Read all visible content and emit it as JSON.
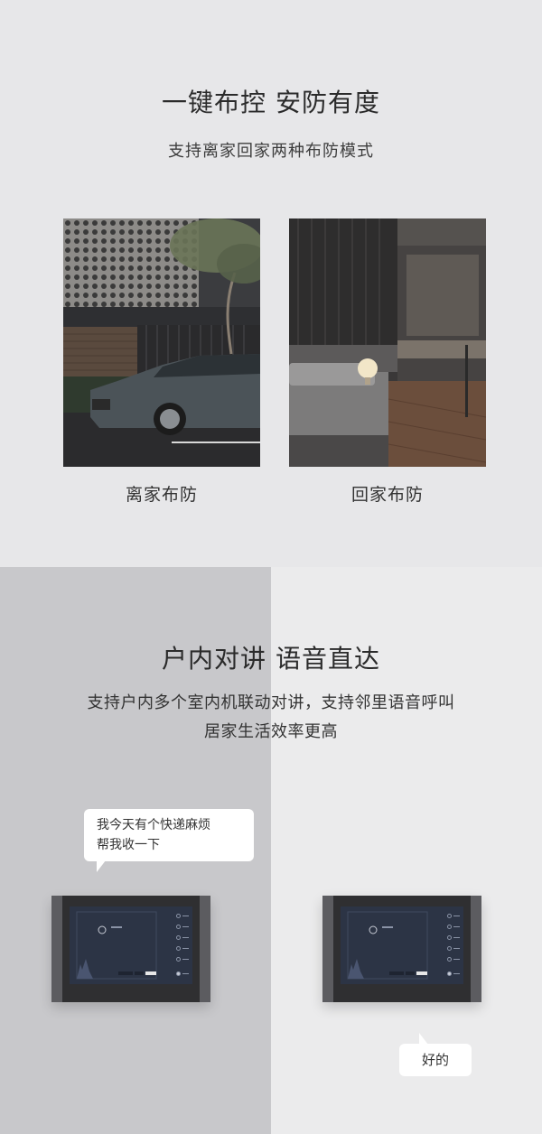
{
  "section1": {
    "title": "一键布控 安防有度",
    "subtitle": "支持离家回家两种布防模式",
    "modes": [
      {
        "caption": "离家布防",
        "image": "exterior-car-scene"
      },
      {
        "caption": "回家布防",
        "image": "bedroom-interior-scene"
      }
    ]
  },
  "section2": {
    "title": "户内对讲 语音直达",
    "desc_line1": "支持户内多个室内机联动对讲，支持邻里语音呼叫",
    "desc_line2": "居家生活效率更高",
    "bubble_left_line1": "我今天有个快递麻烦",
    "bubble_left_line2": "帮我收一下",
    "bubble_right": "好的"
  },
  "colors": {
    "section1_bg": "#e7e7e9",
    "section2_left_bg": "#c8c8cb",
    "section2_right_bg": "#ebebec",
    "device_frame": "#2f2f31",
    "device_screen": "#2c3445"
  }
}
